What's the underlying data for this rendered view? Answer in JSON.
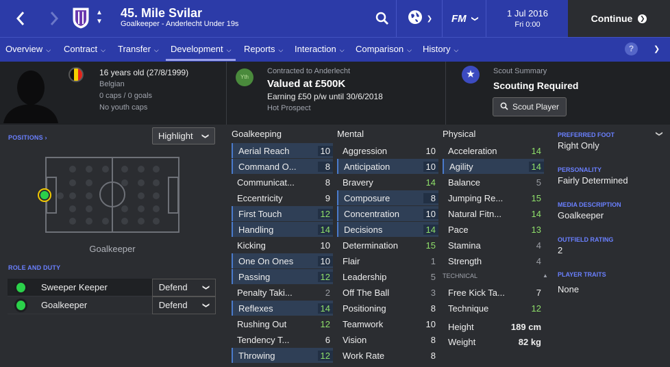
{
  "header": {
    "player_name": "45. Mile Svilar",
    "player_sub": "Goalkeeper - Anderlecht Under 19s",
    "date_line1": "1 Jul 2016",
    "date_line2": "Fri 0:00",
    "fm_label": "FM",
    "continue_label": "Continue"
  },
  "tabs": [
    "Overview",
    "Contract",
    "Transfer",
    "Development",
    "Reports",
    "Interaction",
    "Comparison",
    "History"
  ],
  "active_tab": "Development",
  "profile": {
    "age": "16 years old (27/8/1999)",
    "nationality": "Belgian",
    "caps": "0 caps / 0 goals",
    "youth_caps": "No youth caps",
    "contract_label": "Contracted to Anderlecht",
    "value": "Valued at £500K",
    "earning": "Earning £50 p/w until 30/6/2018",
    "status": "Hot Prospect",
    "yth_badge": "Yth",
    "scout_title": "Scout Summary",
    "scout_status": "Scouting Required",
    "scout_button": "Scout Player"
  },
  "positions": {
    "label": "POSITIONS",
    "highlight": "Highlight",
    "position_name": "Goalkeeper"
  },
  "roles": {
    "label": "ROLE AND DUTY",
    "items": [
      {
        "name": "Sweeper Keeper",
        "duty": "Defend"
      },
      {
        "name": "Goalkeeper",
        "duty": "Defend"
      }
    ]
  },
  "attributes": {
    "goalkeeping_header": "Goalkeeping",
    "mental_header": "Mental",
    "physical_header": "Physical",
    "technical_header": "TECHNICAL",
    "goalkeeping": [
      {
        "name": "Aerial Reach",
        "value": 10
      },
      {
        "name": "Command O...",
        "value": 8
      },
      {
        "name": "Communicat...",
        "value": 8
      },
      {
        "name": "Eccentricity",
        "value": 9
      },
      {
        "name": "First Touch",
        "value": 12
      },
      {
        "name": "Handling",
        "value": 14
      },
      {
        "name": "Kicking",
        "value": 10
      },
      {
        "name": "One On Ones",
        "value": 10
      },
      {
        "name": "Passing",
        "value": 12
      },
      {
        "name": "Penalty Taki...",
        "value": 2
      },
      {
        "name": "Reflexes",
        "value": 14
      },
      {
        "name": "Rushing Out",
        "value": 12
      },
      {
        "name": "Tendency T...",
        "value": 6
      },
      {
        "name": "Throwing",
        "value": 12
      }
    ],
    "mental": [
      {
        "name": "Aggression",
        "value": 10
      },
      {
        "name": "Anticipation",
        "value": 10
      },
      {
        "name": "Bravery",
        "value": 14
      },
      {
        "name": "Composure",
        "value": 8
      },
      {
        "name": "Concentration",
        "value": 10
      },
      {
        "name": "Decisions",
        "value": 14
      },
      {
        "name": "Determination",
        "value": 15
      },
      {
        "name": "Flair",
        "value": 1
      },
      {
        "name": "Leadership",
        "value": 5
      },
      {
        "name": "Off The Ball",
        "value": 3
      },
      {
        "name": "Positioning",
        "value": 8
      },
      {
        "name": "Teamwork",
        "value": 10
      },
      {
        "name": "Vision",
        "value": 8
      },
      {
        "name": "Work Rate",
        "value": 8
      }
    ],
    "physical": [
      {
        "name": "Acceleration",
        "value": 14
      },
      {
        "name": "Agility",
        "value": 14
      },
      {
        "name": "Balance",
        "value": 5
      },
      {
        "name": "Jumping Re...",
        "value": 15
      },
      {
        "name": "Natural Fitn...",
        "value": 14
      },
      {
        "name": "Pace",
        "value": 13
      },
      {
        "name": "Stamina",
        "value": 4
      },
      {
        "name": "Strength",
        "value": 4
      }
    ],
    "technical": [
      {
        "name": "Free Kick Ta...",
        "value": 7
      },
      {
        "name": "Technique",
        "value": 12
      }
    ],
    "height_label": "Height",
    "height_value": "189 cm",
    "weight_label": "Weight",
    "weight_value": "82 kg"
  },
  "side": {
    "preferred_foot_label": "PREFERRED FOOT",
    "preferred_foot": "Right Only",
    "personality_label": "PERSONALITY",
    "personality": "Fairly Determined",
    "media_label": "MEDIA DESCRIPTION",
    "media": "Goalkeeper",
    "outfield_label": "OUTFIELD RATING",
    "outfield": "2",
    "traits_label": "PLAYER TRAITS",
    "traits": "None"
  },
  "colors": {
    "header_blue": "#2c3ba8",
    "green_value": "#8fe06a",
    "accent_label": "#6a80ff"
  },
  "icons": [
    "back-arrow-icon",
    "forward-arrow-icon",
    "club-crest-icon",
    "search-icon",
    "globe-icon",
    "star-icon",
    "help-icon",
    "search-icon"
  ]
}
